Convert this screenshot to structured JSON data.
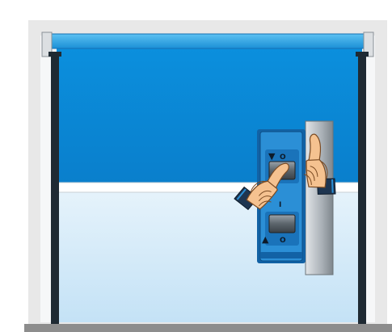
{
  "control_panel": {
    "upper_button": {
      "arrow": "▼",
      "mark": "O"
    },
    "lower_button": {
      "arrow": "▲",
      "mark": "O"
    },
    "divider_mark": "I"
  },
  "colors": {
    "background": "#ffffff",
    "frame": "#e8e8e8",
    "curtain": "#0a88d6",
    "lower_glass_top": "#e6f3fb",
    "lower_glass_bottom": "#c4e2f6",
    "post": "#1f2a33",
    "floor": "#8d8d8d",
    "panel": "#2b8fd6",
    "panel_dark": "#1262a5",
    "hand_skin": "#f5c290",
    "sleeve": "#1e3550"
  },
  "icons": [
    "down-arrow-icon",
    "up-arrow-icon",
    "pointing-hand-icon"
  ]
}
